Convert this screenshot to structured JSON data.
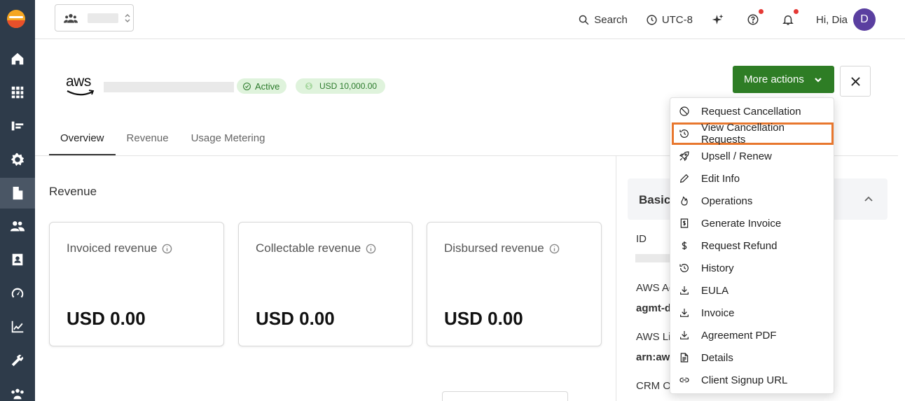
{
  "sidebar": {
    "items": [
      "home",
      "apps",
      "listings",
      "settings",
      "agreements",
      "users",
      "contacts",
      "dashboard",
      "analytics",
      "integrations",
      "partners"
    ]
  },
  "topbar": {
    "search_label": "Search",
    "timezone_label": "UTC-8",
    "greeting": "Hi, Dia",
    "avatar_initial": "D"
  },
  "header": {
    "vendor_logo_text": "aws",
    "status_badge": "Active",
    "amount_badge": "USD 10,000.00",
    "more_actions_label": "More actions"
  },
  "tabs": [
    "Overview",
    "Revenue",
    "Usage Metering"
  ],
  "revenue": {
    "section_title": "Revenue",
    "cards": [
      {
        "label": "Invoiced revenue",
        "value": "USD 0.00"
      },
      {
        "label": "Collectable revenue",
        "value": "USD 0.00"
      },
      {
        "label": "Disbursed revenue",
        "value": "USD 0.00"
      }
    ]
  },
  "details_panel": {
    "title": "Basic",
    "fields": [
      {
        "label": "ID",
        "value": ""
      },
      {
        "label": "AWS Ag",
        "value": "agmt-d"
      },
      {
        "label": "AWS Lic",
        "value": "arn:aw"
      },
      {
        "label": "CRM Op",
        "value": ""
      }
    ]
  },
  "menu": {
    "items": [
      {
        "label": "Request Cancellation",
        "icon": "ban-icon"
      },
      {
        "label": "View Cancellation Requests",
        "icon": "history-icon",
        "highlighted": true
      },
      {
        "label": "Upsell / Renew",
        "icon": "rocket-icon"
      },
      {
        "label": "Edit Info",
        "icon": "pencil-icon"
      },
      {
        "label": "Operations",
        "icon": "flame-icon"
      },
      {
        "label": "Generate Invoice",
        "icon": "invoice-icon"
      },
      {
        "label": "Request Refund",
        "icon": "dollar-icon"
      },
      {
        "label": "History",
        "icon": "history-icon"
      },
      {
        "label": "EULA",
        "icon": "download-icon"
      },
      {
        "label": "Invoice",
        "icon": "download-icon"
      },
      {
        "label": "Agreement PDF",
        "icon": "download-icon"
      },
      {
        "label": "Details",
        "icon": "document-icon"
      },
      {
        "label": "Client Signup URL",
        "icon": "link-icon"
      }
    ]
  },
  "colors": {
    "sidebar": "#2e3b4a",
    "primary_button": "#2e7d25",
    "highlight_border": "#e8772e",
    "badge_bg": "#dff3dc",
    "avatar": "#5a3fa0"
  }
}
